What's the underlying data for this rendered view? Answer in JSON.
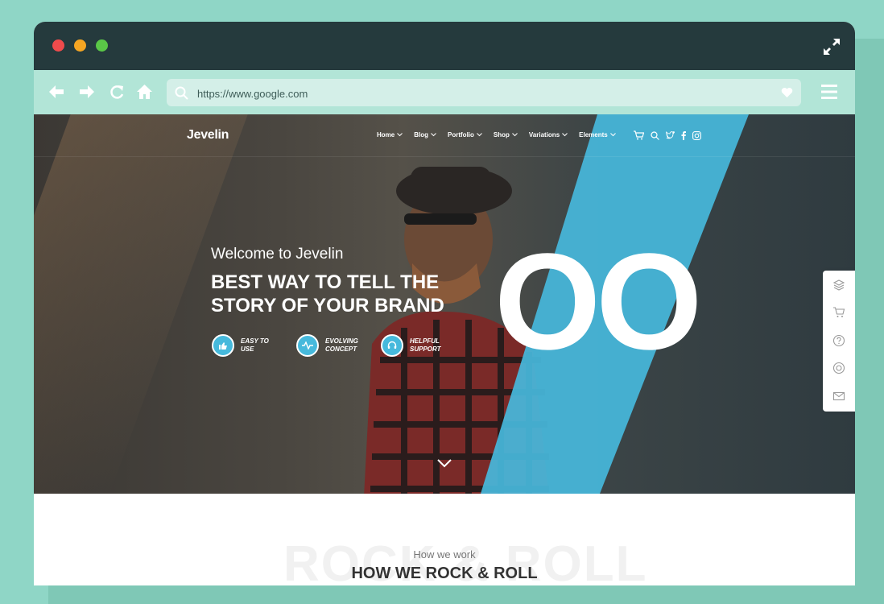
{
  "browser": {
    "url": "https://www.google.com"
  },
  "site": {
    "logo": "Jevelin",
    "nav": [
      {
        "label": "Home"
      },
      {
        "label": "Blog"
      },
      {
        "label": "Portfolio"
      },
      {
        "label": "Shop"
      },
      {
        "label": "Variations"
      },
      {
        "label": "Elements"
      }
    ],
    "nav_icons": [
      "cart-icon",
      "search-icon",
      "twitter-icon",
      "facebook-icon",
      "instagram-icon"
    ]
  },
  "hero": {
    "welcome": "Welcome to Jevelin",
    "headline": "BEST WAY TO TELL THE STORY OF YOUR BRAND",
    "big_text": "OO",
    "features": [
      {
        "label": "EASY TO USE",
        "icon": "thumbs-up-icon"
      },
      {
        "label": "EVOLVING CONCEPT",
        "icon": "pulse-icon"
      },
      {
        "label": "HELPFUL SUPPORT",
        "icon": "headset-icon"
      }
    ],
    "accent_color": "#46b9dc"
  },
  "side_panel": {
    "icons": [
      "layers-icon",
      "cart-icon",
      "help-icon",
      "lifebuoy-icon",
      "mail-icon"
    ]
  },
  "section": {
    "background_text": "ROCK & ROLL",
    "subtitle": "How we work",
    "title": "HOW WE ROCK & ROLL"
  }
}
